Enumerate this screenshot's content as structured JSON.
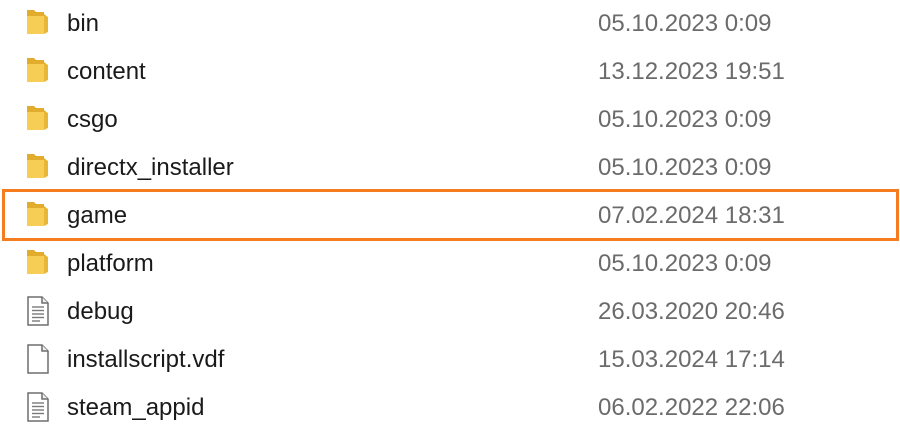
{
  "colors": {
    "folder_fill": "#f6cd55",
    "folder_dark": "#e2ad2d",
    "highlight_border": "#f57c1f",
    "date_text": "#6b6b6b"
  },
  "files": [
    {
      "name": "bin",
      "modified": "05.10.2023 0:09",
      "icon": "folder-icon"
    },
    {
      "name": "content",
      "modified": "13.12.2023 19:51",
      "icon": "folder-icon"
    },
    {
      "name": "csgo",
      "modified": "05.10.2023 0:09",
      "icon": "folder-icon"
    },
    {
      "name": "directx_installer",
      "modified": "05.10.2023 0:09",
      "icon": "folder-icon"
    },
    {
      "name": "game",
      "modified": "07.02.2024 18:31",
      "icon": "folder-icon",
      "highlighted": true
    },
    {
      "name": "platform",
      "modified": "05.10.2023 0:09",
      "icon": "folder-icon"
    },
    {
      "name": "debug",
      "modified": "26.03.2020 20:46",
      "icon": "text-file-icon"
    },
    {
      "name": "installscript.vdf",
      "modified": "15.03.2024 17:14",
      "icon": "blank-file-icon"
    },
    {
      "name": "steam_appid",
      "modified": "06.02.2022 22:06",
      "icon": "text-file-icon"
    }
  ]
}
